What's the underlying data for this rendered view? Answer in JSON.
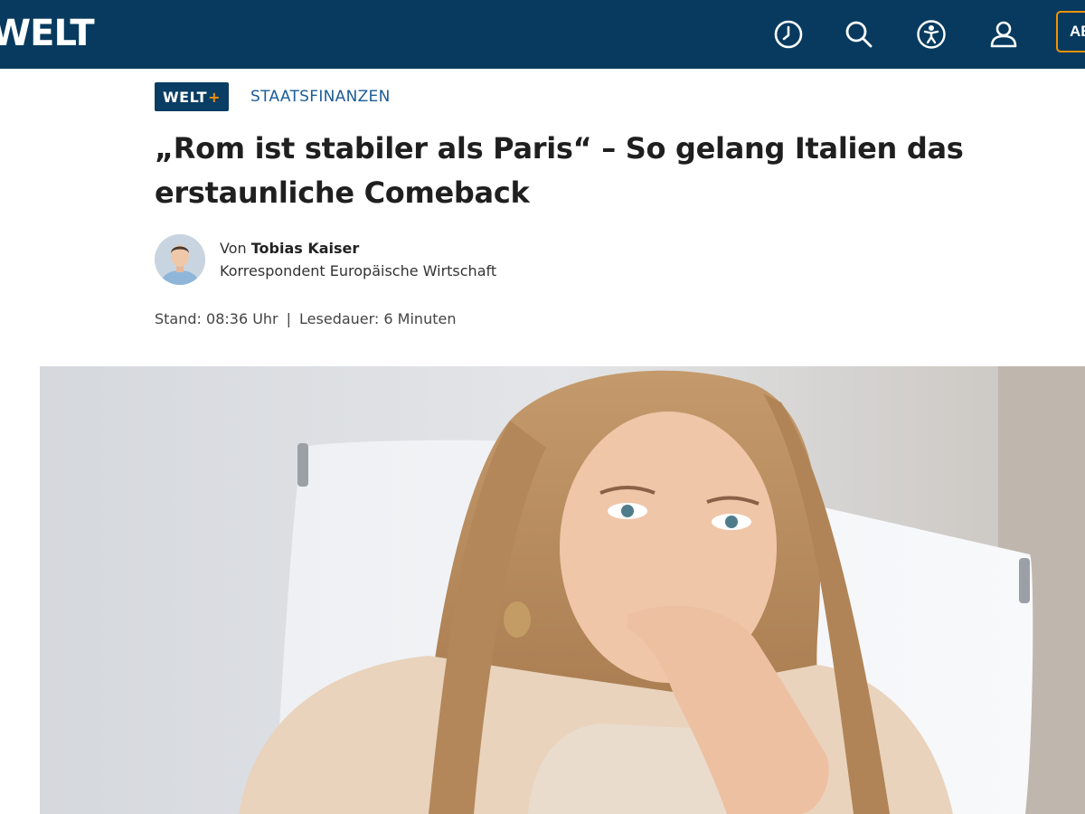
{
  "header": {
    "logo_text": "WELT",
    "icons": [
      "clock-icon",
      "search-icon",
      "accessibility-icon",
      "user-icon"
    ],
    "abo_label": "AB"
  },
  "article": {
    "badge_text": "WELT",
    "badge_plus": "+",
    "kicker": "STAATSFINANZEN",
    "headline": "„Rom ist stabiler als Paris“ – So gelang Italien das erstaunliche Comeback",
    "author": {
      "prefix": "Von",
      "name": "Tobias Kaiser",
      "role": "Korrespondent Europäische Wirtschaft"
    },
    "meta": {
      "stand": "Stand: 08:36 Uhr",
      "separator": "|",
      "reading_time": "Lesedauer: 6 Minuten"
    }
  },
  "colors": {
    "nav_background": "#073a5e",
    "accent_orange": "#f39200",
    "kicker_blue": "#1c5c97",
    "headline": "#1f1f1f"
  }
}
